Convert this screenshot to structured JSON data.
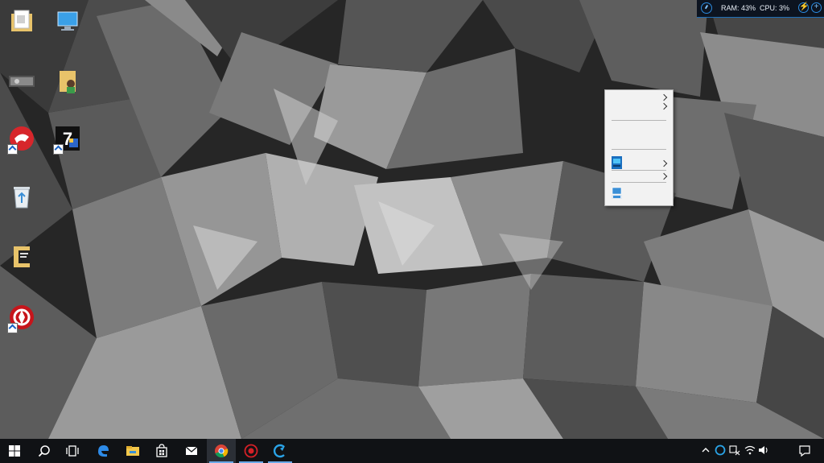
{
  "desktop": {
    "icons": [
      {
        "name": "documents-folder-icon"
      },
      {
        "name": "this-pc-icon"
      },
      {
        "name": "photo-thumbnail-icon"
      },
      {
        "name": "user-folder-icon"
      },
      {
        "name": "antivirus-shortcut-icon"
      },
      {
        "name": "7zip-shortcut-icon"
      },
      {
        "name": "recycle-bin-icon"
      },
      {
        "name": "notes-folder-icon"
      },
      {
        "name": "game-booster-shortcut-icon"
      }
    ]
  },
  "context_menu": {
    "items": [
      {
        "label": "",
        "submenu": true
      },
      {
        "label": "",
        "submenu": true
      },
      {
        "label": "",
        "submenu": false
      },
      {
        "label": "",
        "submenu": false
      },
      {
        "label": "",
        "submenu": true,
        "icon": "display-graphics-icon"
      },
      {
        "label": "",
        "submenu": true
      },
      {
        "label": "",
        "submenu": false,
        "icon": "display-settings-icon"
      }
    ]
  },
  "sys_monitor": {
    "ram_label": "RAM: 43%",
    "cpu_label": "CPU: 3%",
    "accent": "#2b8be0"
  },
  "taskbar": {
    "items": [
      {
        "name": "start-button",
        "icon": "windows-logo-icon"
      },
      {
        "name": "search-button",
        "icon": "search-icon"
      },
      {
        "name": "task-view-button",
        "icon": "task-view-icon"
      },
      {
        "name": "edge-button",
        "icon": "edge-icon"
      },
      {
        "name": "file-explorer-button",
        "icon": "folder-icon"
      },
      {
        "name": "store-button",
        "icon": "store-bag-icon"
      },
      {
        "name": "mail-button",
        "icon": "mail-icon"
      },
      {
        "name": "chrome-button",
        "icon": "chrome-icon"
      },
      {
        "name": "game-booster-button",
        "icon": "game-booster-icon"
      },
      {
        "name": "ccleaner-button",
        "icon": "ccleaner-icon"
      }
    ],
    "tray": [
      "chevron-up-icon",
      "app-tray-icon",
      "ime-icon",
      "wifi-icon",
      "volume-icon"
    ],
    "notification_icon": "action-center-icon"
  }
}
